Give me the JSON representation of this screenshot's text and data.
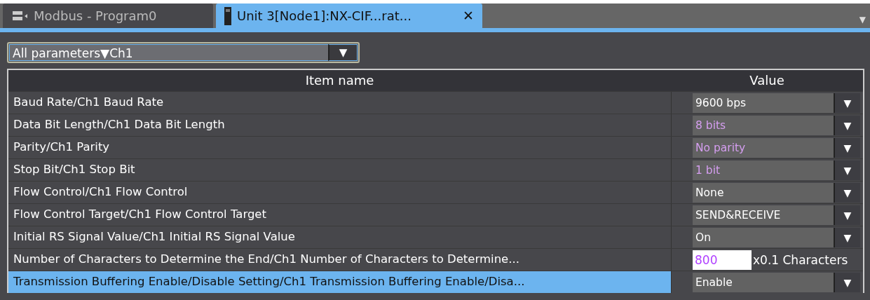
{
  "tabs": [
    {
      "label": "Modbus - Program0",
      "selected": false
    },
    {
      "label": "Unit 3[Node1]:NX-CIF...rat...",
      "selected": true,
      "close": "✕"
    }
  ],
  "tab_menu": "▼",
  "view_select": {
    "value": "All parameters▼Ch1",
    "arrow": "▼"
  },
  "table": {
    "columns": [
      "Item name",
      "Value"
    ],
    "rows": [
      {
        "name": "Baud Rate/Ch1 Baud Rate",
        "kind": "select",
        "value": "9600 bps",
        "changed": false,
        "selected": false,
        "arrow": "▼"
      },
      {
        "name": "Data Bit Length/Ch1 Data Bit Length",
        "kind": "select",
        "value": "8 bits",
        "changed": true,
        "selected": false,
        "arrow": "▼"
      },
      {
        "name": "Parity/Ch1 Parity",
        "kind": "select",
        "value": "No parity",
        "changed": true,
        "selected": false,
        "arrow": "▼"
      },
      {
        "name": "Stop Bit/Ch1 Stop Bit",
        "kind": "select",
        "value": "1 bit",
        "changed": true,
        "selected": false,
        "arrow": "▼"
      },
      {
        "name": "Flow Control/Ch1 Flow Control",
        "kind": "select",
        "value": "None",
        "changed": false,
        "selected": false,
        "arrow": "▼"
      },
      {
        "name": "Flow Control Target/Ch1 Flow Control Target",
        "kind": "select",
        "value": "SEND&RECEIVE",
        "changed": false,
        "selected": false,
        "arrow": "▼"
      },
      {
        "name": "Initial RS Signal Value/Ch1 Initial RS Signal Value",
        "kind": "select",
        "value": "On",
        "changed": false,
        "selected": false,
        "arrow": "▼"
      },
      {
        "name": "Number of Characters to Determine the End/Ch1 Number of Characters to Determine...",
        "kind": "number",
        "value": "800",
        "unit": "x0.1 Characters",
        "changed": true,
        "selected": false
      },
      {
        "name": "Transmission Buffering Enable/Disable Setting/Ch1 Transmission Buffering Enable/Disa...",
        "kind": "select",
        "value": "Enable",
        "changed": false,
        "selected": true,
        "arrow": "▼"
      }
    ]
  }
}
